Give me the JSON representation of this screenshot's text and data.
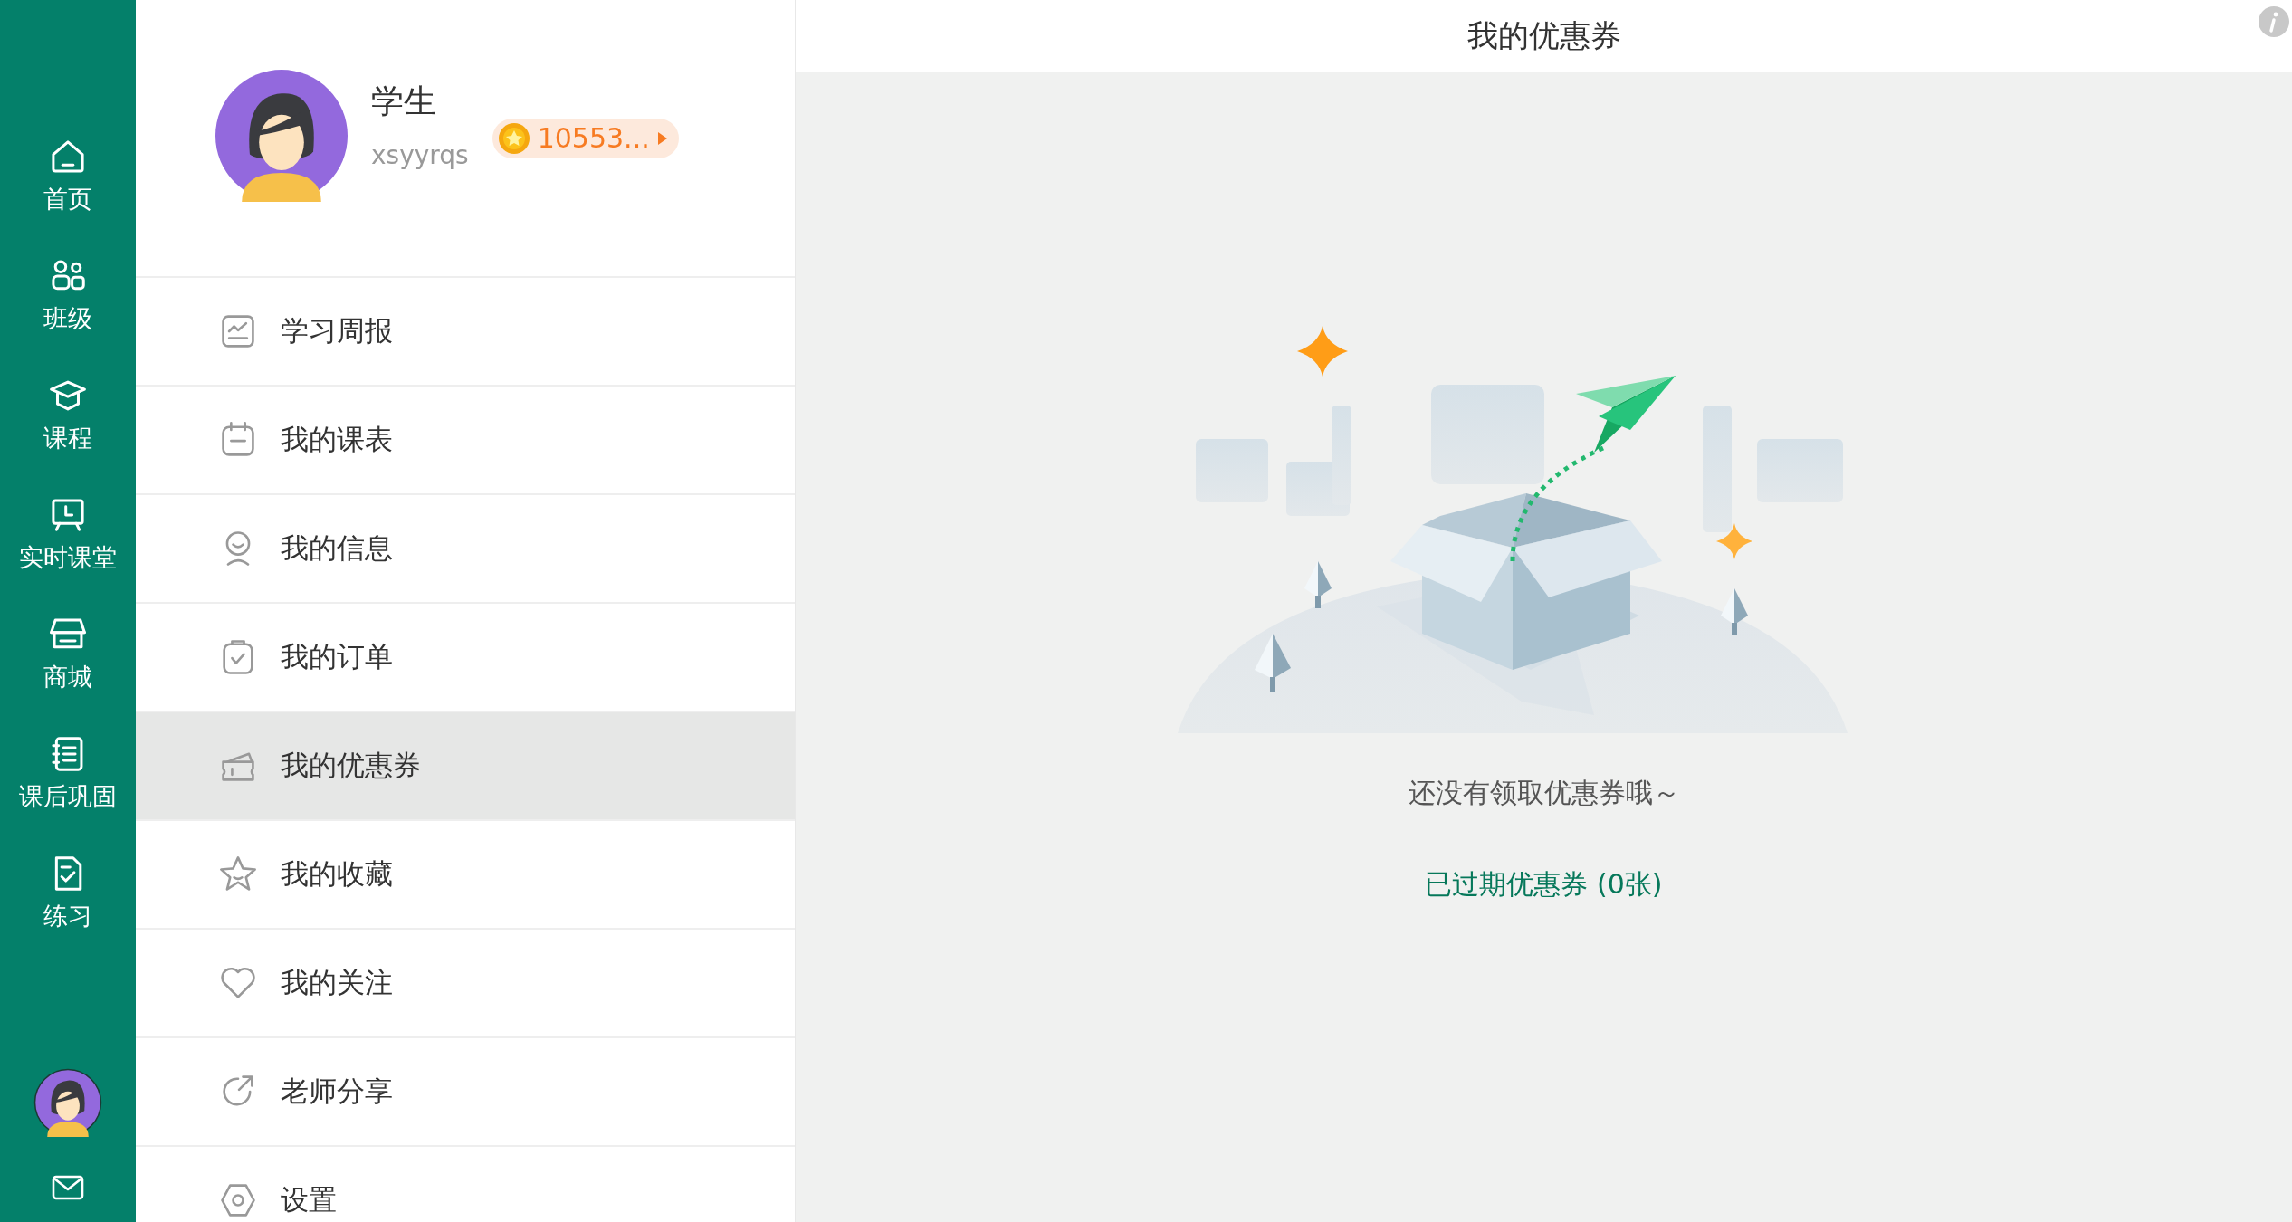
{
  "sidebar": {
    "items": [
      {
        "label": "首页",
        "selected": false
      },
      {
        "label": "班级",
        "selected": false
      },
      {
        "label": "课程",
        "selected": false
      },
      {
        "label": "实时课堂",
        "selected": false
      },
      {
        "label": "商城",
        "selected": false
      },
      {
        "label": "课后巩固",
        "selected": false
      },
      {
        "label": "练习",
        "selected": false
      }
    ]
  },
  "profile": {
    "name": "学生",
    "username": "xsyyrqs",
    "coins": "10553..."
  },
  "menu": {
    "items": [
      {
        "label": "学习周报",
        "selected": false
      },
      {
        "label": "我的课表",
        "selected": false
      },
      {
        "label": "我的信息",
        "selected": false
      },
      {
        "label": "我的订单",
        "selected": false
      },
      {
        "label": "我的优惠券",
        "selected": true
      },
      {
        "label": "我的收藏",
        "selected": false
      },
      {
        "label": "我的关注",
        "selected": false
      },
      {
        "label": "老师分享",
        "selected": false
      },
      {
        "label": "设置",
        "selected": false
      }
    ]
  },
  "page": {
    "title": "我的优惠券",
    "empty_message": "还没有领取优惠券哦～",
    "expired_link": "已过期优惠券 (0张)"
  }
}
